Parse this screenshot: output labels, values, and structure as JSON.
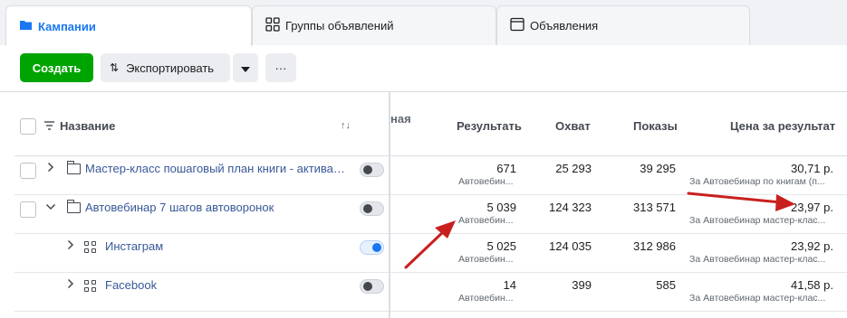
{
  "tabs": [
    {
      "label": "Кампании",
      "icon": "folder-icon"
    },
    {
      "label": "Группы объявлений",
      "icon": "grid-icon"
    },
    {
      "label": "Объявления",
      "icon": "ad-icon"
    }
  ],
  "toolbar": {
    "create_label": "Создать",
    "export_label": "Экспортировать",
    "more_label": "···"
  },
  "columns": {
    "name": "Название",
    "clipped": "ная",
    "results": "Результать",
    "reach": "Охват",
    "impressions": "Показы",
    "cost": "Цена за результат"
  },
  "rows": [
    {
      "name": "Мастер-класс пошаговый план книги - активац...",
      "toggle": "off",
      "results": "671",
      "results_sub": "Автовебин...",
      "reach": "25 293",
      "impressions": "39 295",
      "cost": "30,71 р.",
      "cost_sub": "За Автовебинар по книгам (п..."
    },
    {
      "name": "Автовебинар 7 шагов автоворонок",
      "toggle": "off",
      "results": "5 039",
      "results_sub": "Автовебин...",
      "reach": "124 323",
      "impressions": "313 571",
      "cost": "23,97 р.",
      "cost_sub": "За Автовебинар мастер-клас..."
    },
    {
      "name": "Инстаграм",
      "toggle": "on",
      "results": "5 025",
      "results_sub": "Автовебин...",
      "reach": "124 035",
      "impressions": "312 986",
      "cost": "23,92 р.",
      "cost_sub": "За Автовебинар мастер-клас..."
    },
    {
      "name": "Facebook",
      "toggle": "off",
      "results": "14",
      "results_sub": "Автовебин...",
      "reach": "399",
      "impressions": "585",
      "cost": "41,58 р.",
      "cost_sub": "За Автовебинар мастер-клас..."
    }
  ],
  "colors": {
    "accent": "#1877f2",
    "create": "#00a400",
    "annotation_arrow": "#c8201f"
  }
}
